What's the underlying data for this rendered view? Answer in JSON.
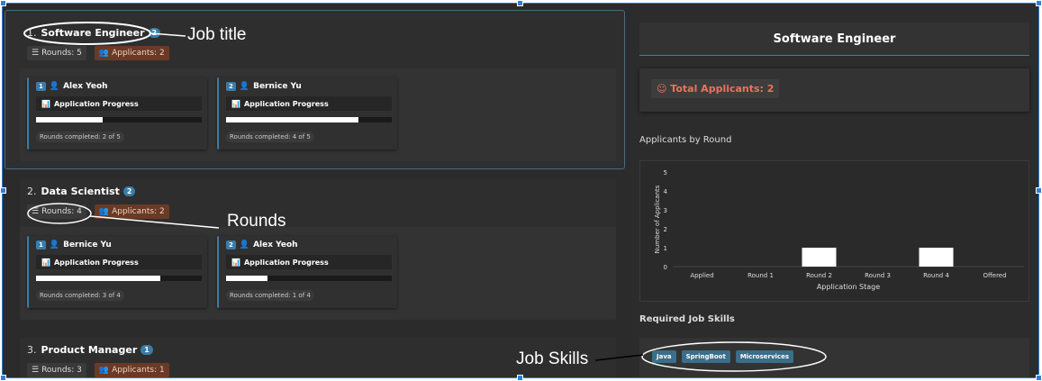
{
  "jobs": [
    {
      "index": "1.",
      "title": "Software Engineer",
      "count": "2",
      "rounds": "Rounds: 5",
      "applicants": "Applicants: 2",
      "candidates": [
        {
          "num": "1",
          "name": "Alex Yeoh",
          "progress_label": "Application Progress",
          "progress": 0.4,
          "rounds_completed": "Rounds completed: 2 of 5"
        },
        {
          "num": "2",
          "name": "Bernice Yu",
          "progress_label": "Application Progress",
          "progress": 0.8,
          "rounds_completed": "Rounds completed: 4 of 5"
        }
      ]
    },
    {
      "index": "2.",
      "title": "Data Scientist",
      "count": "2",
      "rounds": "Rounds: 4",
      "applicants": "Applicants: 2",
      "candidates": [
        {
          "num": "1",
          "name": "Bernice Yu",
          "progress_label": "Application Progress",
          "progress": 0.75,
          "rounds_completed": "Rounds completed: 3 of 4"
        },
        {
          "num": "2",
          "name": "Alex Yeoh",
          "progress_label": "Application Progress",
          "progress": 0.25,
          "rounds_completed": "Rounds completed: 1 of 4"
        }
      ]
    },
    {
      "index": "3.",
      "title": "Product Manager",
      "count": "1",
      "rounds": "Rounds: 3",
      "applicants": "Applicants: 1"
    }
  ],
  "detail": {
    "title": "Software Engineer",
    "total_applicants": "☺ Total Applicants: 2",
    "chart_heading": "Applicants by Round",
    "skills_heading": "Required Job Skills",
    "skills": [
      "Java",
      "SpringBoot",
      "Microservices"
    ]
  },
  "chart_data": {
    "type": "bar",
    "categories": [
      "Applied",
      "Round 1",
      "Round 2",
      "Round 3",
      "Round 4",
      "Offered"
    ],
    "values": [
      0,
      0,
      1,
      0,
      1,
      0
    ],
    "xlabel": "Application Stage",
    "ylabel": "Number of Applicants",
    "ylim": [
      0,
      5
    ],
    "yticks": [
      "0",
      "1",
      "2",
      "3",
      "4",
      "5"
    ],
    "grid": false
  },
  "annotations": {
    "job_title": "Job title",
    "rounds": "Rounds",
    "job_skills": "Job Skills"
  },
  "colors": {
    "accent": "#3a7ca8",
    "applicants_tag": "#6a3a26",
    "total_text": "#e8745a"
  }
}
